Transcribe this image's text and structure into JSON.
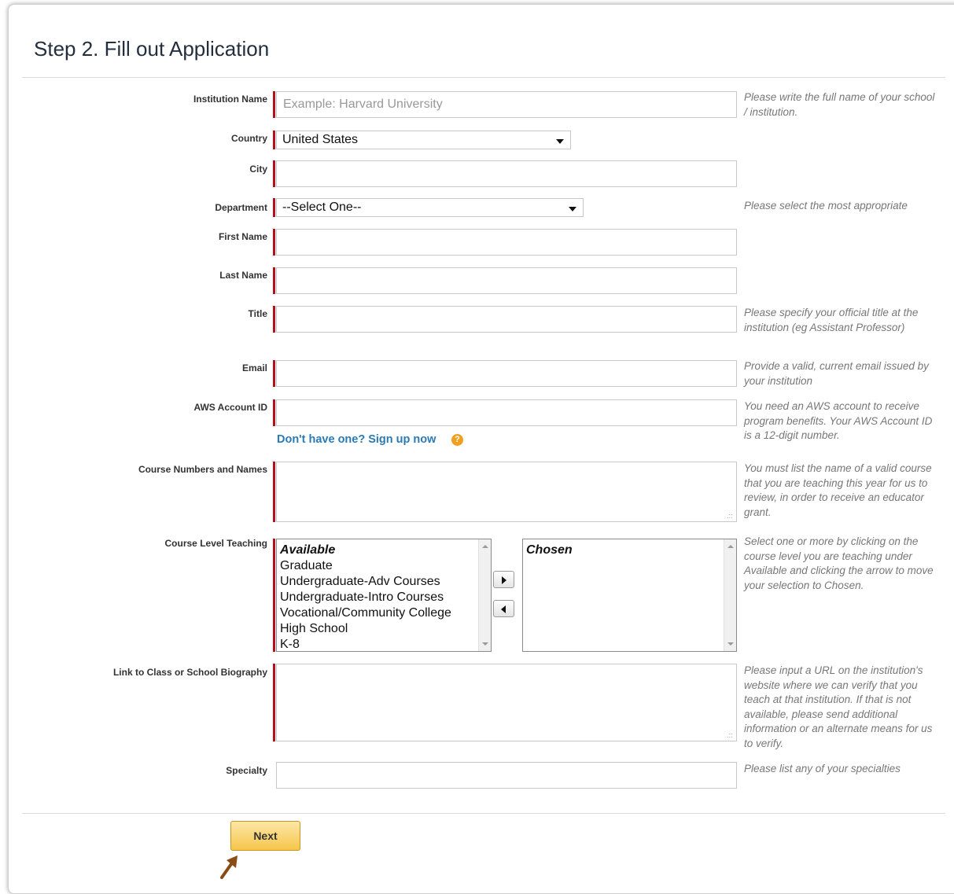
{
  "page": {
    "title": "Step 2. Fill out Application"
  },
  "fields": {
    "institution": {
      "label": "Institution Name",
      "placeholder": "Example: Harvard University",
      "help": "Please write the full name of your school / institution."
    },
    "country": {
      "label": "Country",
      "value": "United States"
    },
    "city": {
      "label": "City"
    },
    "department": {
      "label": "Department",
      "value": "--Select One--",
      "help": "Please select the most appropriate"
    },
    "first_name": {
      "label": "First Name"
    },
    "last_name": {
      "label": "Last Name"
    },
    "title": {
      "label": "Title",
      "help": "Please specify your official title at the institution (eg Assistant Professor)"
    },
    "email": {
      "label": "Email",
      "help": "Provide a valid, current email issued by your institution"
    },
    "aws_id": {
      "label": "AWS Account ID",
      "help": "You need an AWS account to receive program benefits. Your AWS Account ID is a 12-digit number.",
      "signup_link": "Don't have one? Sign up now",
      "info_icon": "question-icon"
    },
    "courses": {
      "label": "Course Numbers and Names",
      "help": "You must list the name of a valid course that you are teaching this year for us to review, in order to receive an educator grant."
    },
    "course_level": {
      "label": "Course Level Teaching",
      "available_header": "Available",
      "available_items": [
        "Graduate",
        "Undergraduate-Adv Courses",
        "Undergraduate-Intro Courses",
        "Vocational/Community College",
        "High School",
        "K-8"
      ],
      "chosen_header": "Chosen",
      "help": "Select one or more by clicking on the course level you are teaching under Available and clicking the arrow to move your selection to Chosen."
    },
    "biography": {
      "label": "Link to Class or School Biography",
      "help": "Please input a URL on the institution's website where we can verify that you teach at that institution. If that is not available, please send additional information or an alternate means for us to verify."
    },
    "specialty": {
      "label": "Specialty",
      "help": "Please list any of your specialties"
    }
  },
  "actions": {
    "next_label": "Next"
  },
  "colors": {
    "required_marker": "#b4111d",
    "link": "#2a7ab6",
    "button": "#f5c64a",
    "pointer_arrow": "#8a4b14"
  }
}
